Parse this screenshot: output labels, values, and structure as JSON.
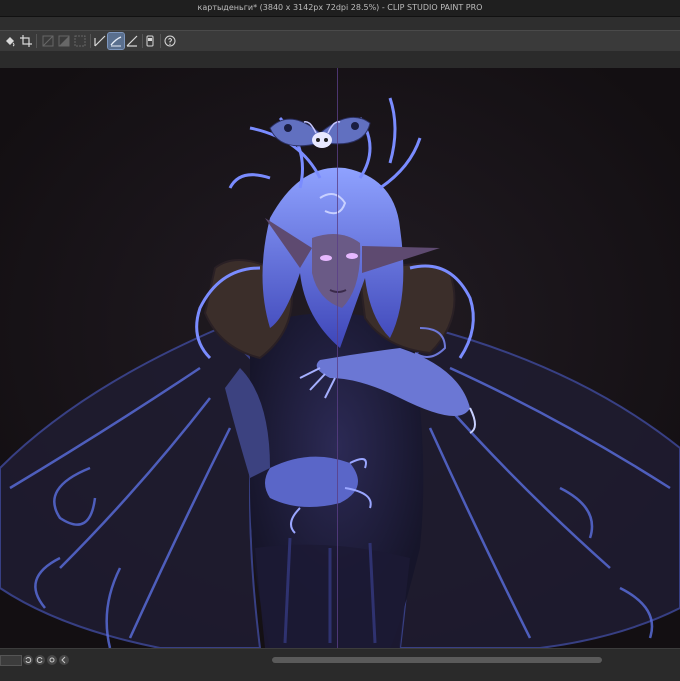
{
  "window": {
    "title": "картыденьги* (3840 x 3142px 72dpi 28.5%)  - CLIP STUDIO PAINT PRO"
  },
  "toolbar": {
    "buttons": [
      {
        "name": "fill-icon",
        "state": "normal"
      },
      {
        "name": "crop-icon",
        "state": "normal"
      },
      {
        "name": "clear-outside-icon",
        "state": "disabled"
      },
      {
        "name": "fill-selection-icon",
        "state": "disabled"
      },
      {
        "name": "select-all-icon",
        "state": "disabled"
      },
      {
        "name": "ruler-snap-icon",
        "state": "normal"
      },
      {
        "name": "special-ruler-snap-icon",
        "state": "active"
      },
      {
        "name": "grid-snap-icon",
        "state": "normal"
      },
      {
        "name": "device-icon",
        "state": "normal"
      },
      {
        "name": "help-icon",
        "state": "normal"
      }
    ]
  },
  "canvas": {
    "background_color": "#161214",
    "accent_color": "#5b6fe0",
    "guide_color": "#5a3f86",
    "image_description_icon": "painted-character-artwork"
  },
  "statusbar": {
    "icons": [
      "zoom-field",
      "rotate-left-icon",
      "rotate-right-icon",
      "reset-rotation-icon",
      "flip-icon"
    ]
  }
}
